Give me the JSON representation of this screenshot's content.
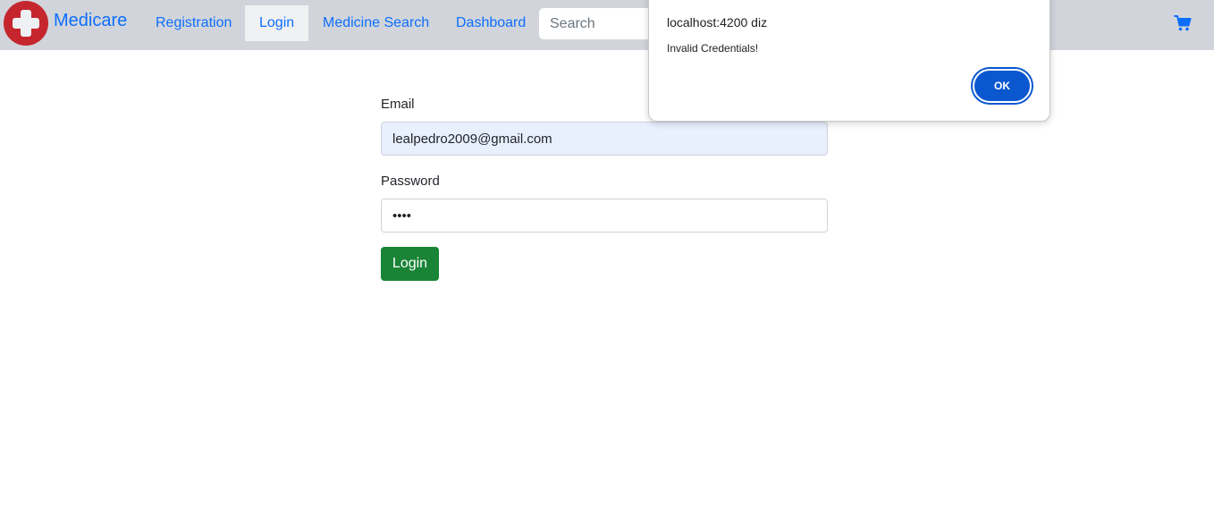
{
  "navbar": {
    "brand": "Medicare",
    "links": [
      {
        "label": "Registration",
        "active": false
      },
      {
        "label": "Login",
        "active": true
      },
      {
        "label": "Medicine Search",
        "active": false
      },
      {
        "label": "Dashboard",
        "active": false
      }
    ],
    "search": {
      "placeholder": "Search",
      "value": ""
    },
    "icons": {
      "logo": "medical-cross-icon",
      "cart": "shopping-cart-icon"
    },
    "colors": {
      "background": "#d1d5db",
      "link": "#0d6efd",
      "logo": "#c5262e"
    }
  },
  "login_form": {
    "email_label": "Email",
    "email_value": "lealpedro2009@gmail.com",
    "password_label": "Password",
    "password_value": "••••",
    "submit_label": "Login",
    "submit_color": "#198436"
  },
  "alert": {
    "title": "localhost:4200 diz",
    "message": "Invalid Credentials!",
    "ok_label": "OK",
    "ok_color": "#0b57d0"
  }
}
